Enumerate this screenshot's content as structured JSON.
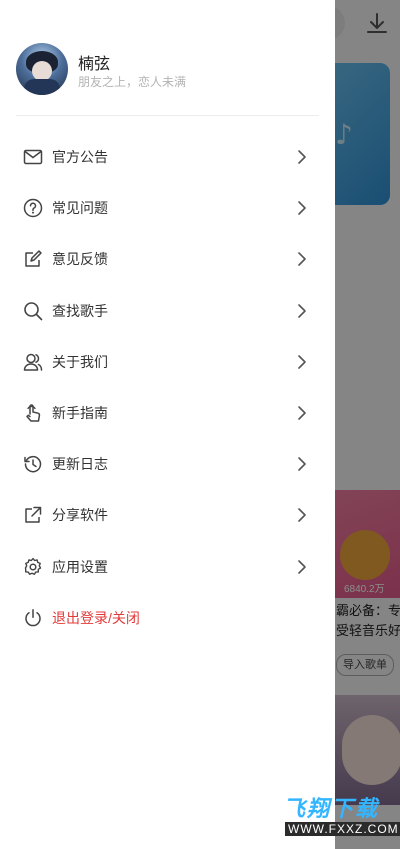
{
  "user": {
    "name": "楠弦",
    "signature": "朋友之上，恋人未满"
  },
  "menu": [
    {
      "label": "官方公告",
      "icon": "mail-icon"
    },
    {
      "label": "常见问题",
      "icon": "question-circle-icon"
    },
    {
      "label": "意见反馈",
      "icon": "edit-square-icon"
    },
    {
      "label": "查找歌手",
      "icon": "search-icon"
    },
    {
      "label": "关于我们",
      "icon": "users-icon"
    },
    {
      "label": "新手指南",
      "icon": "hand-pointer-icon"
    },
    {
      "label": "更新日志",
      "icon": "history-icon"
    },
    {
      "label": "分享软件",
      "icon": "share-icon"
    },
    {
      "label": "应用设置",
      "icon": "gear-icon"
    },
    {
      "label": "退出登录/关闭",
      "icon": "power-icon"
    }
  ],
  "background": {
    "play_count": "6840.2万",
    "playlist_title_line1": "霸必备：专",
    "playlist_title_line2": "受轻音乐好",
    "import_button": "导入歌单"
  },
  "watermark": {
    "title": "飞翔下载",
    "url": "WWW.FXXZ.COM"
  },
  "colors": {
    "logout_text": "#e23b3b",
    "overlay": "rgba(0,0,0,0.45)",
    "watermark_title": "#33b6ff"
  }
}
